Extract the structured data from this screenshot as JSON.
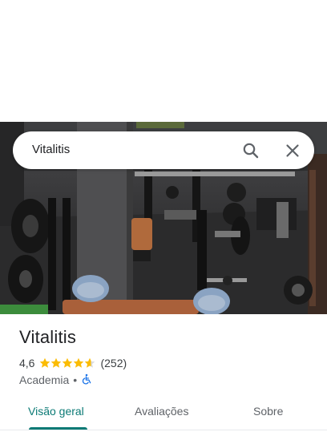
{
  "search": {
    "query": "Vitalitis"
  },
  "place": {
    "name": "Vitalitis",
    "rating": "4,6",
    "rating_stars": 4.6,
    "review_count": "(252)",
    "category": "Academia",
    "separator": "•"
  },
  "tabs": [
    {
      "label": "Visão geral",
      "active": true
    },
    {
      "label": "Avaliações",
      "active": false
    },
    {
      "label": "Sobre",
      "active": false
    }
  ],
  "colors": {
    "accent": "#0b7a75",
    "star": "#fbbc04",
    "accessibility": "#1a73e8"
  },
  "icons": {
    "search": "search-icon",
    "close": "close-icon",
    "accessibility": "wheelchair-icon"
  }
}
